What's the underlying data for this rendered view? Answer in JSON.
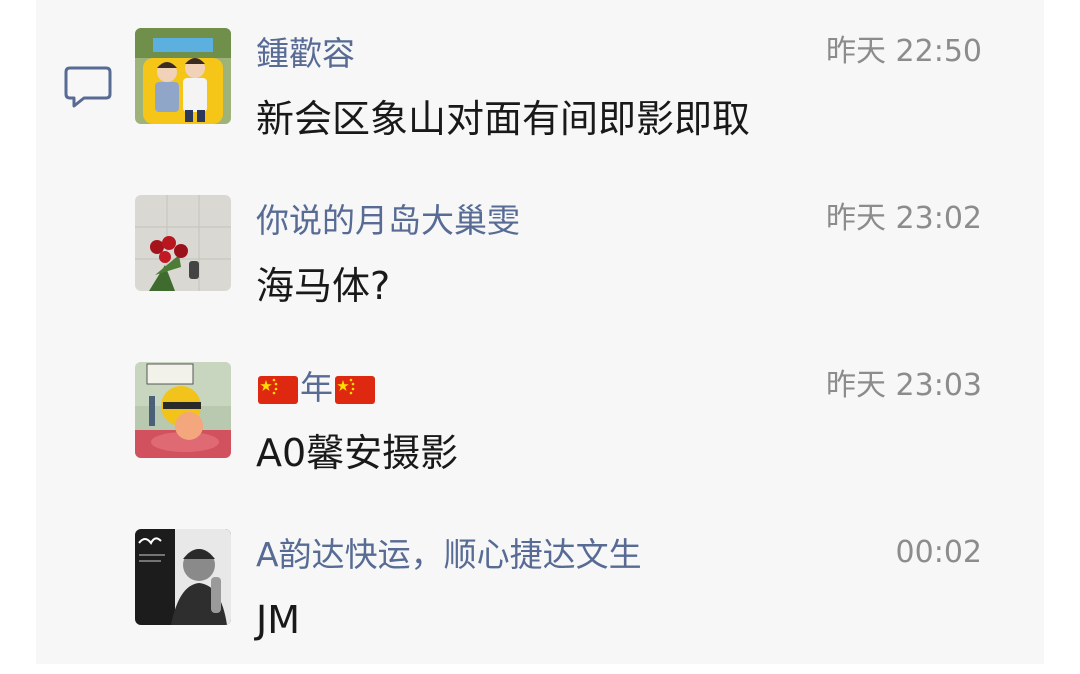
{
  "comments": [
    {
      "name": "鍾歡容",
      "time": "昨天 22:50",
      "text": "新会区象山对面有间即影即取",
      "avatar": "photo-two-children"
    },
    {
      "name": "你说的月岛大巢雯",
      "time": "昨天 23:02",
      "text": "海马体?",
      "avatar": "photo-red-roses"
    },
    {
      "name": "年",
      "time": "昨天 23:03",
      "text": "A0馨安摄影",
      "avatar": "cartoon-character",
      "name_flags": "china-flag"
    },
    {
      "name": "A韵达快运，顺心捷达文生",
      "time": "00:02",
      "text": "JM",
      "avatar": "photo-man-black-white"
    }
  ],
  "colors": {
    "name": "#576b95",
    "time": "#8c8c8c",
    "text": "#191919",
    "background": "#f7f7f7",
    "flag_red": "#de2910",
    "flag_star": "#ffde00"
  },
  "icons": {
    "comment": "comment-bubble-icon"
  }
}
